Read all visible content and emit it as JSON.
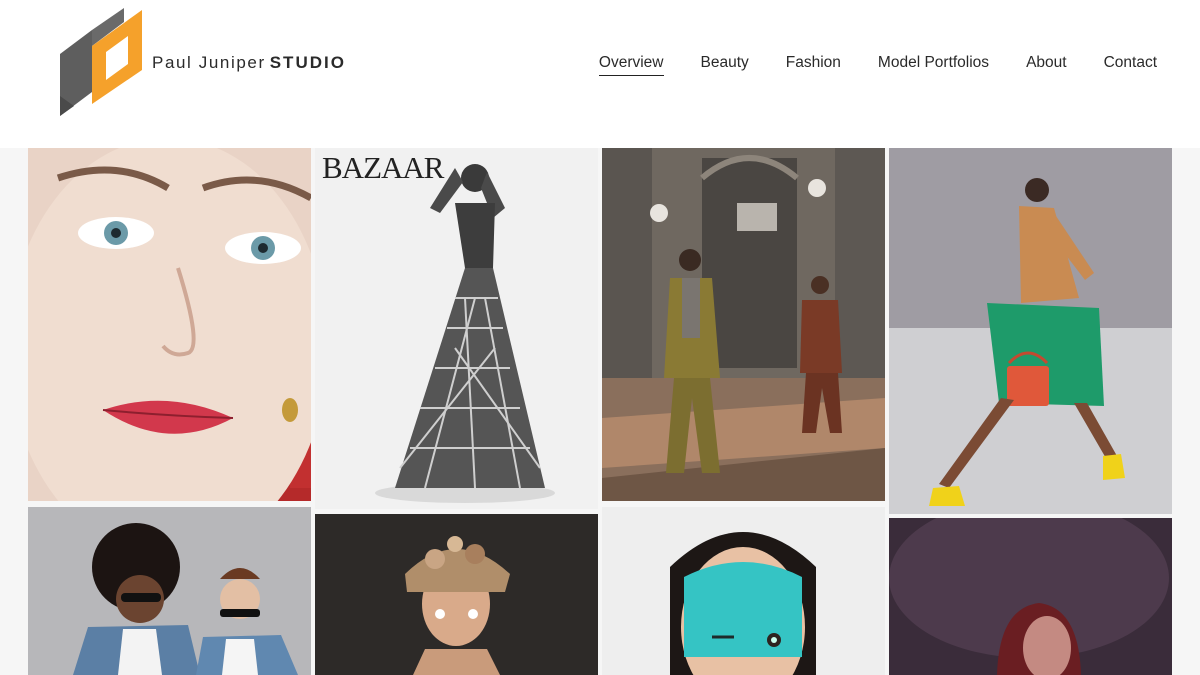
{
  "brand": {
    "name_light": "Paul Juniper",
    "name_bold": "STUDIO"
  },
  "nav": {
    "items": [
      {
        "label": "Overview",
        "active": true
      },
      {
        "label": "Beauty",
        "active": false
      },
      {
        "label": "Fashion",
        "active": false
      },
      {
        "label": "Model Portfolios",
        "active": false
      },
      {
        "label": "About",
        "active": false
      },
      {
        "label": "Contact",
        "active": false
      }
    ]
  },
  "gallery": {
    "magazine_label": "BAZAAR"
  },
  "colors": {
    "logo_orange": "#f5a12b",
    "logo_gray": "#5e5e5e",
    "text": "#2a2a2a",
    "background": "#ffffff"
  }
}
